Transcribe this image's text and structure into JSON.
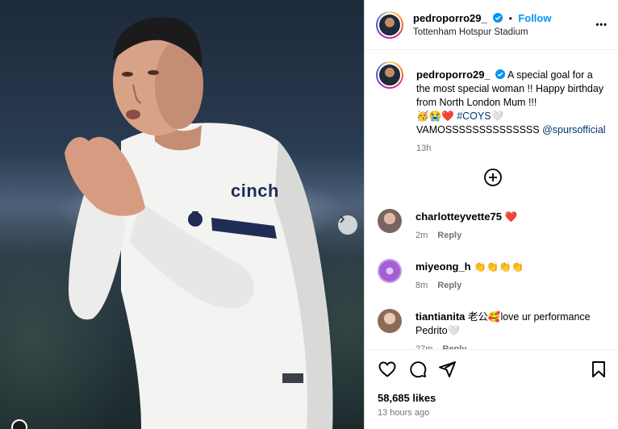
{
  "header": {
    "username": "pedroporro29_",
    "separator": "•",
    "follow_label": "Follow",
    "location": "Tottenham Hotspur Stadium",
    "more_label": "•••"
  },
  "photo": {
    "shirt_sponsor": "cinch"
  },
  "caption": {
    "username": "pedroporro29_",
    "text": "A special goal for a the most special woman !! Happy birthday from North London Mum !!!",
    "emoji_line": "🥳😭❤️",
    "hashtag": "#COYS",
    "heart": "🤍",
    "line3": "VAMOSSSSSSSSSSSSSS",
    "mention": "@spursofficial",
    "age": "13h"
  },
  "comments": [
    {
      "username": "charlotteyvette75",
      "text": "❤️",
      "age": "2m",
      "reply_label": "Reply"
    },
    {
      "username": "miyeong_h",
      "text": "👏👏👏👏",
      "age": "8m",
      "reply_label": "Reply"
    },
    {
      "username": "tiantianita",
      "text": "老公🥰love ur performance Pedrito🤍",
      "age": "27m",
      "reply_label": "Reply"
    }
  ],
  "footer": {
    "likes": "58,685 likes",
    "posted": "13 hours ago"
  },
  "colors": {
    "link": "#0095f6",
    "muted": "#737373",
    "like_heart": "#ed4956"
  }
}
